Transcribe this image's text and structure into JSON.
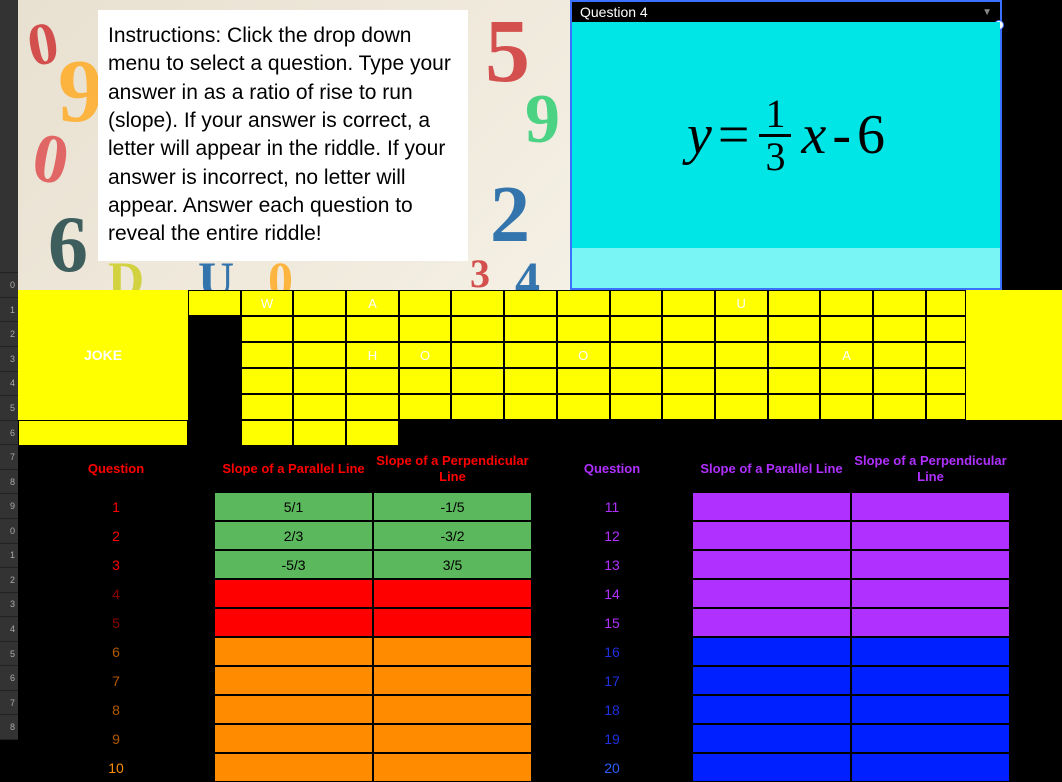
{
  "instructions": "Instructions:  Click the drop down menu to select a question. Type your answer in as a ratio of rise to run (slope).  If your answer is correct, a letter will appear in the riddle.  If your answer is incorrect, no letter will appear.  Answer each question to reveal the entire riddle!",
  "dropdown": {
    "selected": "Question 4"
  },
  "equation": {
    "lhs": "y",
    "eq": "=",
    "num": "1",
    "den": "3",
    "var": "x",
    "op": "-",
    "const": "6"
  },
  "joke": {
    "label": "JOKE",
    "row1": [
      "",
      "W",
      "",
      "A",
      "",
      "",
      "",
      "",
      "",
      "",
      "U",
      "",
      "",
      "",
      ""
    ],
    "row2": [
      "",
      "",
      "",
      "",
      "",
      "",
      "",
      "",
      "",
      "",
      "",
      "",
      "",
      "",
      ""
    ],
    "row3": [
      "",
      "H",
      "O",
      "",
      "",
      "O",
      "",
      "",
      "",
      "",
      "A",
      "",
      "",
      "",
      ""
    ],
    "row4": [
      "",
      "",
      "",
      "",
      "",
      "",
      "",
      "",
      "",
      "",
      "",
      "",
      "",
      "",
      ""
    ],
    "row5": [
      "",
      "",
      "",
      "",
      "",
      "",
      "",
      "",
      "",
      "",
      "",
      "",
      "",
      "",
      ""
    ]
  },
  "headers": {
    "q": "Question",
    "par": "Slope of a Parallel Line",
    "perp": "Slope of a Perpendicular Line"
  },
  "left_rows": [
    {
      "n": "1",
      "par": "5/1",
      "perp": "-1/5",
      "fill": "green",
      "ncolor": "txt-red"
    },
    {
      "n": "2",
      "par": "2/3",
      "perp": "-3/2",
      "fill": "green",
      "ncolor": "txt-red"
    },
    {
      "n": "3",
      "par": "-5/3",
      "perp": "3/5",
      "fill": "green",
      "ncolor": "txt-red"
    },
    {
      "n": "4",
      "par": "",
      "perp": "",
      "fill": "red-bg",
      "ncolor": "txt-darkred"
    },
    {
      "n": "5",
      "par": "",
      "perp": "",
      "fill": "red-bg",
      "ncolor": "txt-darkred"
    },
    {
      "n": "6",
      "par": "",
      "perp": "",
      "fill": "orange",
      "ncolor": "txt-darkorange"
    },
    {
      "n": "7",
      "par": "",
      "perp": "",
      "fill": "orange",
      "ncolor": "txt-darkorange"
    },
    {
      "n": "8",
      "par": "",
      "perp": "",
      "fill": "orange",
      "ncolor": "txt-darkorange"
    },
    {
      "n": "9",
      "par": "",
      "perp": "",
      "fill": "orange",
      "ncolor": "txt-darkorange"
    },
    {
      "n": "10",
      "par": "",
      "perp": "",
      "fill": "orange",
      "ncolor": "txt-orange"
    }
  ],
  "right_rows": [
    {
      "n": "11",
      "fill": "purple",
      "ncolor": "txt-purple"
    },
    {
      "n": "12",
      "fill": "purple",
      "ncolor": "txt-purple"
    },
    {
      "n": "13",
      "fill": "purple",
      "ncolor": "txt-purple"
    },
    {
      "n": "14",
      "fill": "purple",
      "ncolor": "txt-purple"
    },
    {
      "n": "15",
      "fill": "purple",
      "ncolor": "txt-purple"
    },
    {
      "n": "16",
      "fill": "blue",
      "ncolor": "txt-darkblue"
    },
    {
      "n": "17",
      "fill": "blue",
      "ncolor": "txt-darkblue"
    },
    {
      "n": "18",
      "fill": "blue",
      "ncolor": "txt-darkblue"
    },
    {
      "n": "19",
      "fill": "blue",
      "ncolor": "txt-darkblue"
    },
    {
      "n": "20",
      "fill": "blue",
      "ncolor": "txt-blue"
    }
  ],
  "row_numbers": [
    "",
    "",
    "",
    "",
    "",
    "",
    "",
    "",
    "",
    "0",
    "1",
    "2",
    "3",
    "4",
    "5",
    "6",
    "7",
    "8",
    "9",
    "0",
    "1",
    "2",
    "3",
    "4",
    "5",
    "6",
    "7",
    "8"
  ]
}
